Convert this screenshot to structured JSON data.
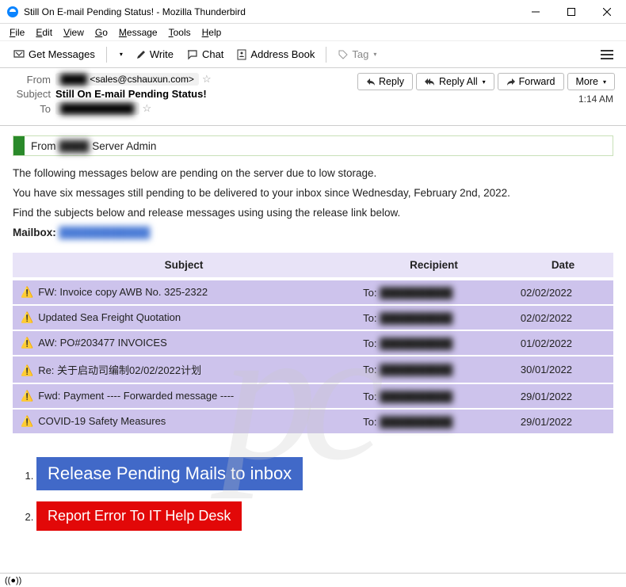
{
  "window": {
    "title": "Still On E-mail Pending Status! - Mozilla Thunderbird"
  },
  "menu": {
    "items": [
      "File",
      "Edit",
      "View",
      "Go",
      "Message",
      "Tools",
      "Help"
    ]
  },
  "toolbar": {
    "get_messages": "Get Messages",
    "write": "Write",
    "chat": "Chat",
    "address_book": "Address Book",
    "tag": "Tag"
  },
  "header": {
    "from_label": "From",
    "from_name_redacted": "████",
    "from_email": "<sales@cshauxun.com>",
    "subject_label": "Subject",
    "subject": "Still On E-mail Pending Status!",
    "to_label": "To",
    "to_redacted": "███████████",
    "reply": "Reply",
    "reply_all": "Reply All",
    "forward": "Forward",
    "more": "More",
    "time": "1:14 AM"
  },
  "body": {
    "banner_prefix": "From",
    "banner_redacted": "████",
    "banner_suffix": "Server Admin",
    "p1": "The following messages below are pending on the server due to low storage.",
    "p2": "You have six messages still pending to be delivered to your inbox since Wednesday, February 2nd, 2022.",
    "p3": "Find the subjects below and release messages using using the release link below.",
    "mailbox_label": "Mailbox:",
    "mailbox_redacted": "████████████"
  },
  "table": {
    "cols": {
      "subject": "Subject",
      "recipient": "Recipient",
      "date": "Date"
    },
    "to_label": "To:",
    "recipient_redacted": "██████████",
    "rows": [
      {
        "subject": "FW: Invoice copy AWB No. 325-2322",
        "date": "02/02/2022"
      },
      {
        "subject": "Updated Sea Freight Quotation",
        "date": "02/02/2022"
      },
      {
        "subject": "AW: PO#203477 INVOICES",
        "date": "01/02/2022"
      },
      {
        "subject": "Re: 关于启动司编制02/02/2022计划",
        "date": "30/01/2022"
      },
      {
        "subject": "Fwd: Payment ---- Forwarded message ----",
        "date": "29/01/2022"
      },
      {
        "subject": "COVID-19 Safety Measures",
        "date": "29/01/2022"
      }
    ]
  },
  "actions": {
    "release": "Release Pending Mails to inbox",
    "report": "Report Error To IT Help Desk"
  }
}
